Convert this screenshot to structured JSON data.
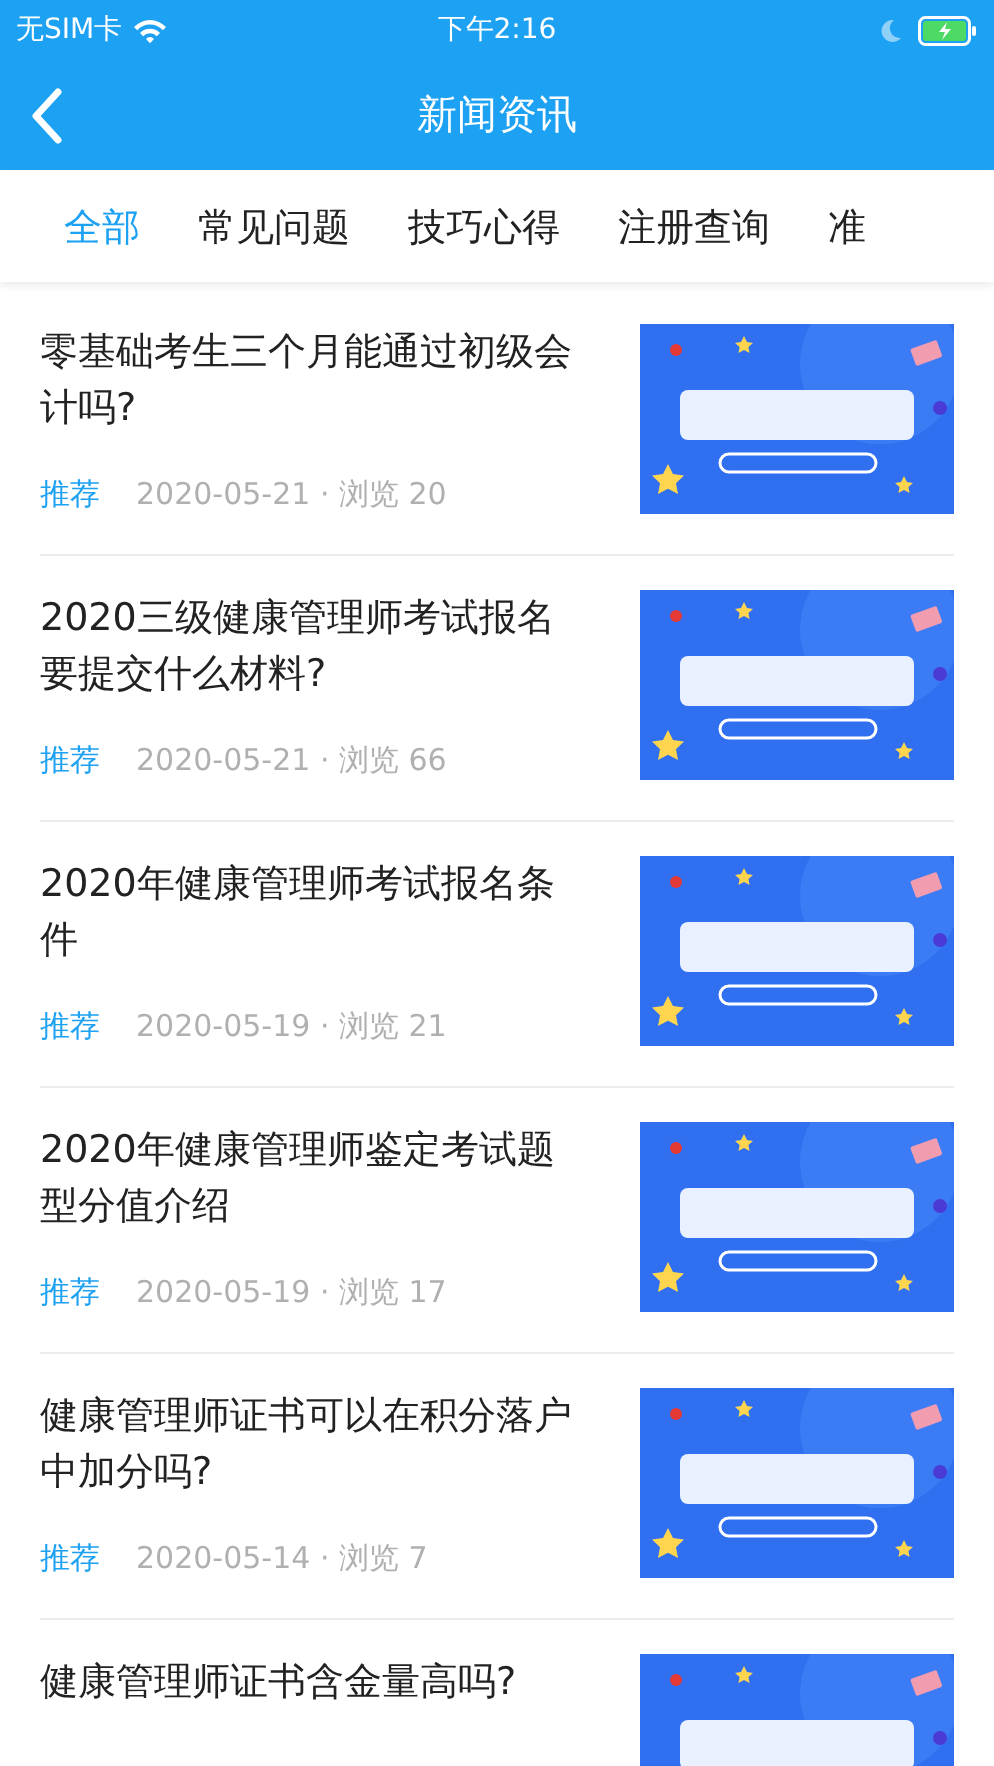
{
  "status_bar": {
    "carrier": "无SIM卡",
    "time": "下午2:16",
    "battery_charging": true
  },
  "nav": {
    "title": "新闻资讯"
  },
  "tabs": [
    {
      "label": "全部",
      "selected": true
    },
    {
      "label": "常见问题",
      "selected": false
    },
    {
      "label": "技巧心得",
      "selected": false
    },
    {
      "label": "注册查询",
      "selected": false
    },
    {
      "label": "准",
      "selected": false
    }
  ],
  "articles": [
    {
      "title": "零基础考生三个月能通过初级会计吗?",
      "tag": "推荐",
      "meta": "2020-05-21 · 浏览 20"
    },
    {
      "title": "2020三级健康管理师考试报名要提交什么材料?",
      "tag": "推荐",
      "meta": "2020-05-21 · 浏览 66"
    },
    {
      "title": "2020年健康管理师考试报名条件",
      "tag": "推荐",
      "meta": "2020-05-19 · 浏览 21"
    },
    {
      "title": "2020年健康管理师鉴定考试题型分值介绍",
      "tag": "推荐",
      "meta": "2020-05-19 · 浏览 17"
    },
    {
      "title": "健康管理师证书可以在积分落户中加分吗?",
      "tag": "推荐",
      "meta": "2020-05-14 · 浏览 7"
    },
    {
      "title": "健康管理师证书含金量高吗?"
    }
  ]
}
